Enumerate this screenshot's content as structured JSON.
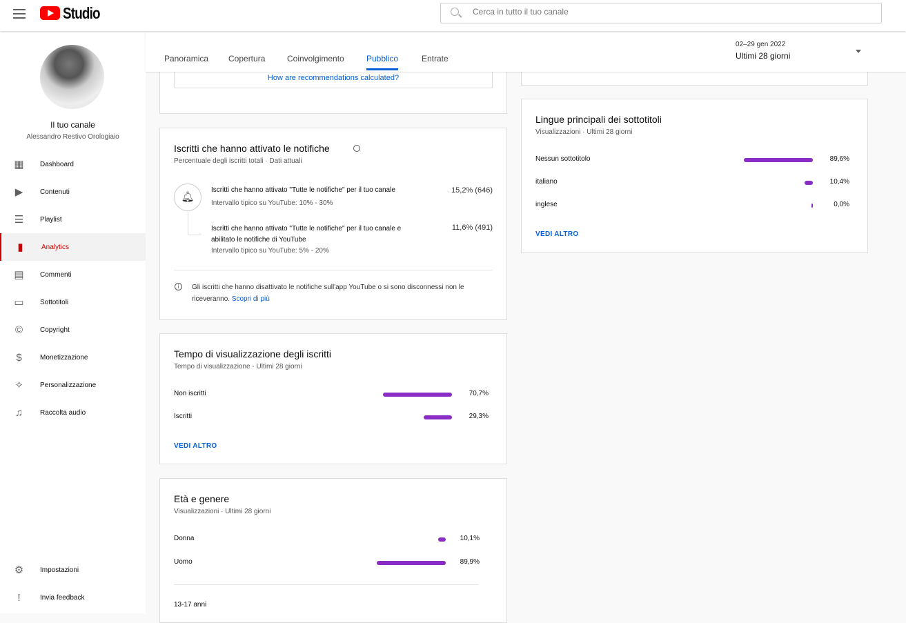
{
  "app": {
    "logo_text": "Studio",
    "search_placeholder": "Cerca in tutto il tuo canale"
  },
  "channel": {
    "title": "Il tuo canale",
    "name": "Alessandro Restivo Orologiaio"
  },
  "sidebar": {
    "items": [
      {
        "label": "Dashboard",
        "icon": "dashboard-icon",
        "glyph": "▦"
      },
      {
        "label": "Contenuti",
        "icon": "video-icon",
        "glyph": "▶"
      },
      {
        "label": "Playlist",
        "icon": "playlist-icon",
        "glyph": "☰"
      },
      {
        "label": "Analytics",
        "icon": "analytics-icon",
        "glyph": "▮",
        "active": true
      },
      {
        "label": "Commenti",
        "icon": "comment-icon",
        "glyph": "▤"
      },
      {
        "label": "Sottotitoli",
        "icon": "subtitles-icon",
        "glyph": "▭"
      },
      {
        "label": "Copyright",
        "icon": "copyright-icon",
        "glyph": "©"
      },
      {
        "label": "Monetizzazione",
        "icon": "dollar-icon",
        "glyph": "$"
      },
      {
        "label": "Personalizzazione",
        "icon": "magic-wand-icon",
        "glyph": "✧"
      },
      {
        "label": "Raccolta audio",
        "icon": "audio-library-icon",
        "glyph": "♫"
      }
    ],
    "bottom": [
      {
        "label": "Impostazioni",
        "icon": "gear-icon",
        "glyph": "⚙"
      },
      {
        "label": "Invia feedback",
        "icon": "feedback-icon",
        "glyph": "!"
      }
    ]
  },
  "tabs": [
    "Panoramica",
    "Copertura",
    "Coinvolgimento",
    "Pubblico",
    "Entrate"
  ],
  "active_tab": "Pubblico",
  "date": {
    "range": "02–29 gen 2022",
    "label": "Ultimi 28 giorni"
  },
  "recommend_link": "How are recommendations calculated?",
  "notifications": {
    "title": "Iscritti che hanno attivato le notifiche",
    "subtitle": "Percentuale degli iscritti totali · Dati attuali",
    "row1": {
      "text": "Iscritti che hanno attivato \"Tutte le notifiche\" per il tuo canale",
      "range": "Intervallo tipico su YouTube: 10% - 30%",
      "value": "15,2% (646)"
    },
    "row2": {
      "text": "Iscritti che hanno attivato \"Tutte le notifiche\" per il tuo canale e abilitato le notifiche di YouTube",
      "range": "Intervallo tipico su YouTube: 5% - 20%",
      "value": "11,6% (491)"
    },
    "info": "Gli iscritti che hanno disattivato le notifiche sull'app YouTube o si sono disconnessi non le riceveranno.",
    "learn_more": "Scopri di più"
  },
  "watch_time": {
    "title": "Tempo di visualizzazione degli iscritti",
    "subtitle": "Tempo di visualizzazione · Ultimi 28 giorni",
    "rows": [
      {
        "label": "Non iscritti",
        "value": 70.7,
        "text": "70,7%"
      },
      {
        "label": "Iscritti",
        "value": 29.3,
        "text": "29,3%"
      }
    ],
    "more": "VEDI ALTRO"
  },
  "age_gender": {
    "title": "Età e genere",
    "subtitle": "Visualizzazioni · Ultimi 28 giorni",
    "rows": [
      {
        "label": "Donna",
        "value": 10.1,
        "text": "10,1%"
      },
      {
        "label": "Uomo",
        "value": 89.9,
        "text": "89,9%"
      }
    ],
    "age_first": "13-17 anni"
  },
  "subtitles": {
    "title": "Lingue principali dei sottotitoli",
    "subtitle": "Visualizzazioni · Ultimi 28 giorni",
    "rows": [
      {
        "label": "Nessun sottotitolo",
        "value": 89.6,
        "text": "89,6%"
      },
      {
        "label": "italiano",
        "value": 10.4,
        "text": "10,4%"
      },
      {
        "label": "inglese",
        "value": 0.0,
        "text": "0,0%"
      }
    ],
    "more": "VEDI ALTRO"
  },
  "colors": {
    "bar": "#8a2dc4",
    "accent": "#065fd4",
    "brand": "#ff0000"
  }
}
